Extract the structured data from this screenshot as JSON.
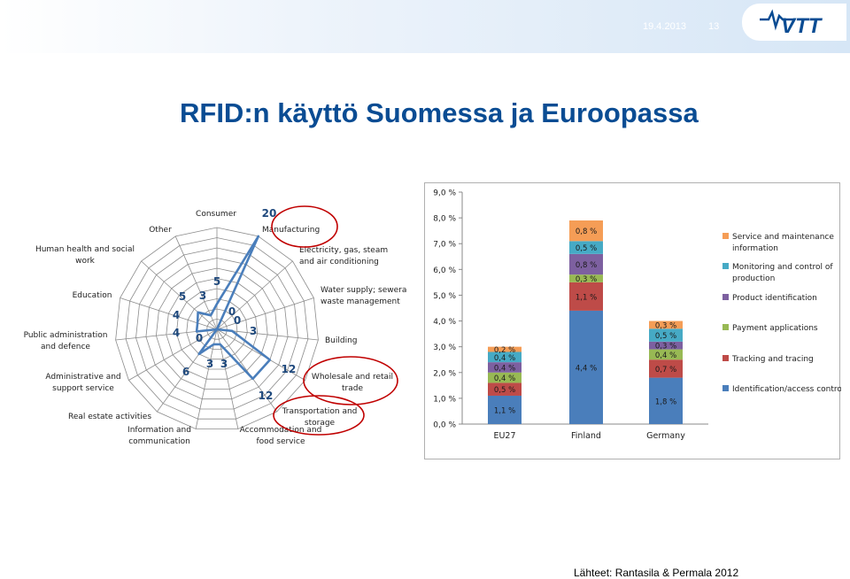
{
  "header": {
    "date": "19.4.2013",
    "page_number": "13",
    "logo_text": "VTT"
  },
  "title": "RFID:n käyttö Suomessa ja Euroopassa",
  "source": "Lähteet: Rantasila & Permala 2012",
  "colors": {
    "title": "#0a4c93",
    "radar_line": "#4a7ebb",
    "radar_value": "#1f497d",
    "highlight_circle": "#c00000",
    "identification": "#4a7ebb",
    "tracking": "#be4b48",
    "payment": "#98b954",
    "product": "#7d60a0",
    "monitoring": "#46aac5",
    "service": "#f59d56"
  },
  "chart_data": [
    {
      "type": "radar",
      "title": "",
      "categories": [
        "Manufacturing",
        "Electricity, gas, steam and air conditioning",
        "Water supply; sewerage, waste management",
        "Building",
        "Wholesale and retail trade",
        "Transportation and storage",
        "Accommodation and food service",
        "Information and communication",
        "Real estate activities",
        "Administrative and support service",
        "Public administration and defence",
        "Education",
        "Human health and social work",
        "Other",
        "Consumer"
      ],
      "values": [
        20,
        0,
        0,
        3,
        12,
        12,
        3,
        3,
        6,
        0,
        4,
        4,
        5,
        3,
        5
      ],
      "highlighted": [
        "Manufacturing",
        "Wholesale and retail trade",
        "Transportation and storage"
      ],
      "grid_rings": 10,
      "max": 20
    },
    {
      "type": "bar",
      "stacked": true,
      "title": "",
      "categories": [
        "EU27",
        "Finland",
        "Germany"
      ],
      "y_ticks": [
        "0,0 %",
        "1,0 %",
        "2,0 %",
        "3,0 %",
        "4,0 %",
        "5,0 %",
        "6,0 %",
        "7,0 %",
        "8,0 %",
        "9,0 %"
      ],
      "ylim": [
        0,
        9
      ],
      "legend_position": "right",
      "series": [
        {
          "name": "Identification/access control",
          "values": [
            1.1,
            4.4,
            1.8
          ],
          "labels": [
            "1,1 %",
            "4,4 %",
            "1,8 %"
          ],
          "color": "#4a7ebb"
        },
        {
          "name": "Tracking and tracing",
          "values": [
            0.5,
            1.1,
            0.7
          ],
          "labels": [
            "0,5 %",
            "1,1 %",
            "0,7 %"
          ],
          "color": "#be4b48"
        },
        {
          "name": "Payment applications",
          "values": [
            0.4,
            0.3,
            0.4
          ],
          "labels": [
            "0,4 %",
            "0,3 %",
            "0,4 %"
          ],
          "color": "#98b954"
        },
        {
          "name": "Product identification",
          "values": [
            0.4,
            0.8,
            0.3
          ],
          "labels": [
            "0,4 %",
            "0,8 %",
            "0,3 %"
          ],
          "color": "#7d60a0"
        },
        {
          "name": "Monitoring and control of production",
          "values": [
            0.4,
            0.5,
            0.5
          ],
          "labels": [
            "0,4 %",
            "0,5 %",
            "0,5 %"
          ],
          "color": "#46aac5"
        },
        {
          "name": "Service and maintenance information",
          "values": [
            0.2,
            0.8,
            0.3
          ],
          "labels": [
            "0,2 %",
            "0,8 %",
            "0,3 %"
          ],
          "color": "#f59d56"
        }
      ]
    }
  ]
}
